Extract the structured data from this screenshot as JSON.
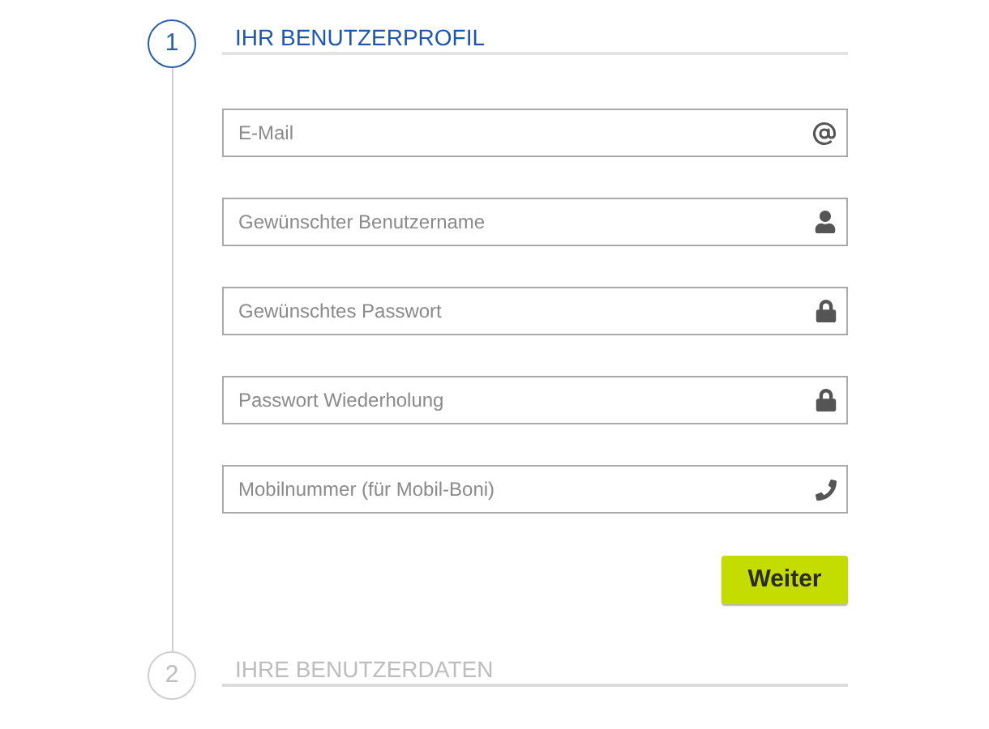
{
  "steps": [
    {
      "number": "1",
      "title": "IHR BENUTZERPROFIL",
      "active": true,
      "fields": [
        {
          "placeholder": "E-Mail",
          "kind": "email"
        },
        {
          "placeholder": "Gewünschter Benutzername",
          "kind": "user"
        },
        {
          "placeholder": "Gewünschtes Passwort",
          "kind": "password"
        },
        {
          "placeholder": "Passwort Wiederholung",
          "kind": "password"
        },
        {
          "placeholder": "Mobilnummer (für Mobil-Boni)",
          "kind": "phone"
        }
      ],
      "button": "Weiter"
    },
    {
      "number": "2",
      "title": "IHRE BENUTZERDATEN",
      "active": false
    }
  ]
}
